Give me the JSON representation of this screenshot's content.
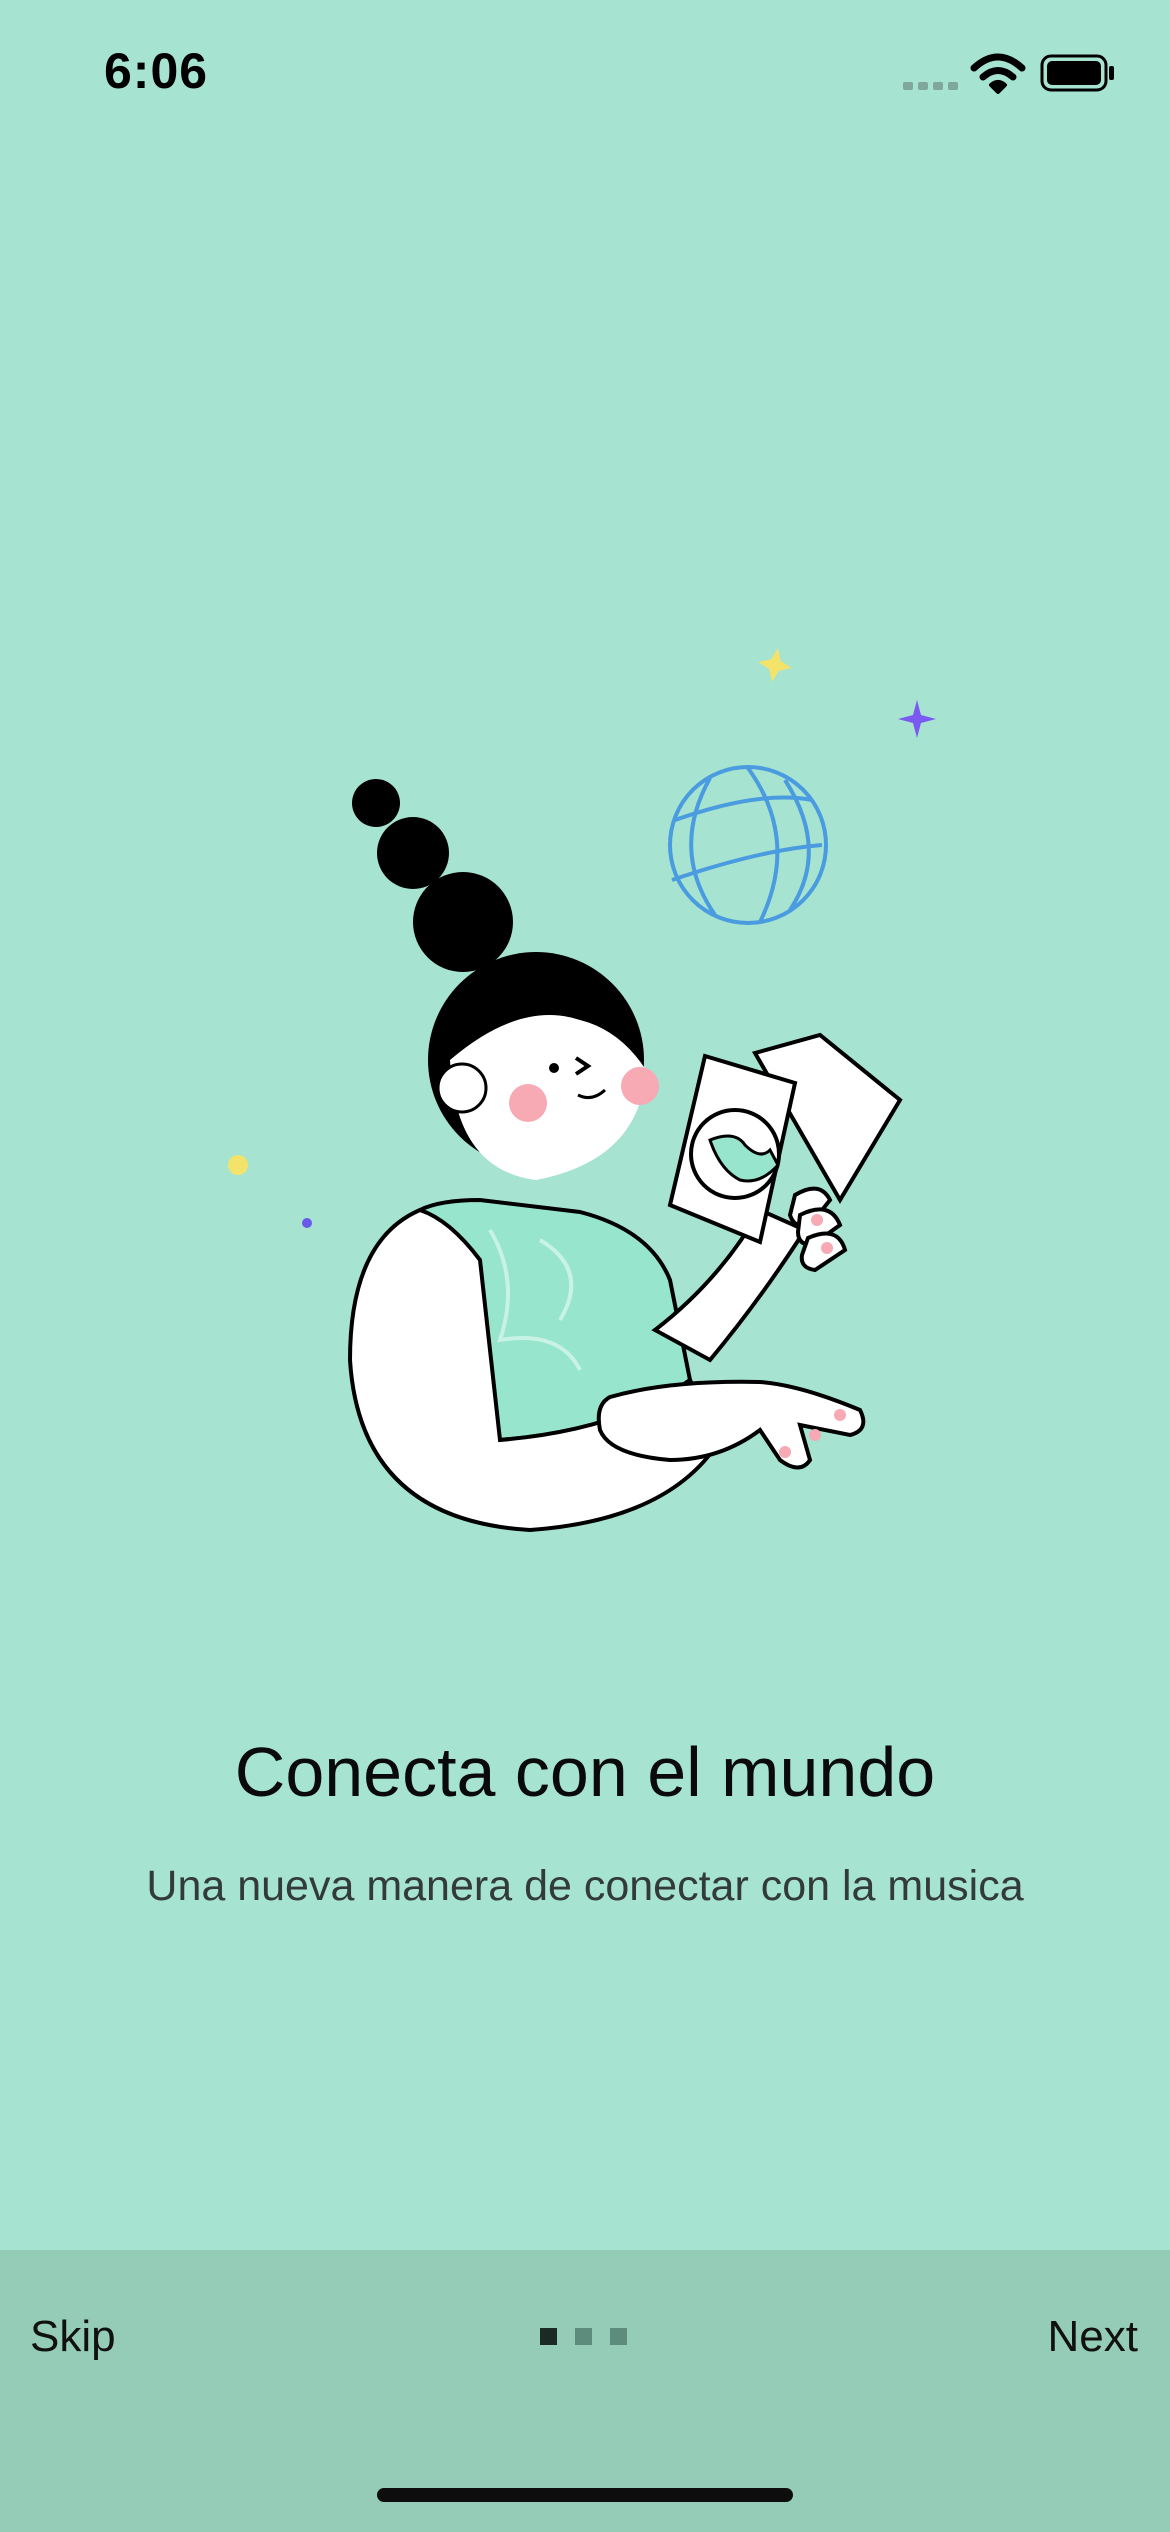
{
  "status_bar": {
    "time": "6:06"
  },
  "icons": {
    "signal": "cellular-signal-icon",
    "wifi": "wifi-icon",
    "battery": "battery-icon"
  },
  "onboarding": {
    "title": "Conecta con el mundo",
    "subtitle": "Una nueva manera de conectar con la musica"
  },
  "navigation": {
    "skip_label": "Skip",
    "next_label": "Next",
    "page_count": 3,
    "current_page": 1
  },
  "colors": {
    "background": "#a6e3d0",
    "bottom_bar": "#94ccb8",
    "active_dot": "#1c2a25",
    "inactive_dot": "#5d8c7d"
  }
}
